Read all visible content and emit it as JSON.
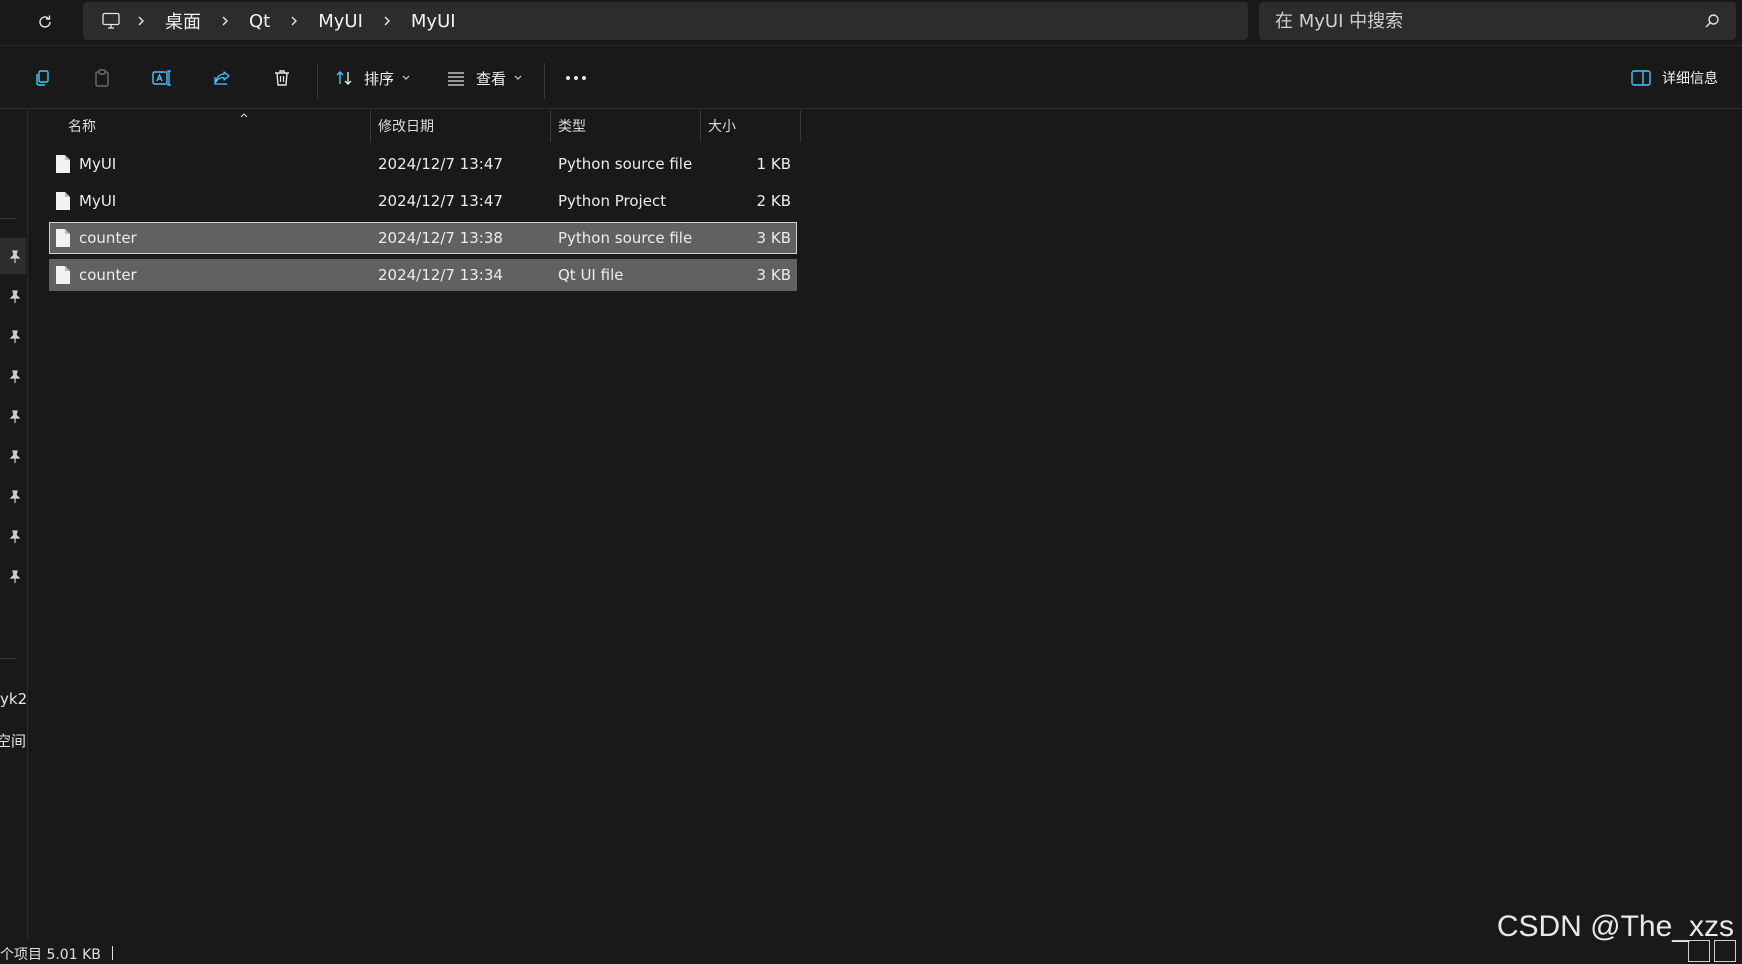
{
  "address": {
    "crumbs": [
      "桌面",
      "Qt",
      "MyUI",
      "MyUI"
    ]
  },
  "search": {
    "placeholder": "在 MyUI 中搜索"
  },
  "toolbar": {
    "sort_label": "排序",
    "view_label": "查看",
    "details_label": "详细信息"
  },
  "columns": {
    "name": "名称",
    "date": "修改日期",
    "type": "类型",
    "size": "大小"
  },
  "files": [
    {
      "name": "MyUI",
      "date": "2024/12/7 13:47",
      "type": "Python source file",
      "size": "1 KB"
    },
    {
      "name": "MyUI",
      "date": "2024/12/7 13:47",
      "type": "Python Project",
      "size": "2 KB"
    },
    {
      "name": "counter",
      "date": "2024/12/7 13:38",
      "type": "Python source file",
      "size": "3 KB"
    },
    {
      "name": "counter",
      "date": "2024/12/7 13:34",
      "type": "Qt UI file",
      "size": "3 KB"
    }
  ],
  "nav": {
    "label1": "yk2",
    "label2": "空间"
  },
  "status": {
    "text": "个项目  5.01 KB"
  },
  "watermark": "CSDN @The_xzs",
  "colors": {
    "background": "#191919",
    "selected_row": "#616161",
    "box": "#2c2c2c",
    "accent_icon": "#4cc2ff"
  }
}
